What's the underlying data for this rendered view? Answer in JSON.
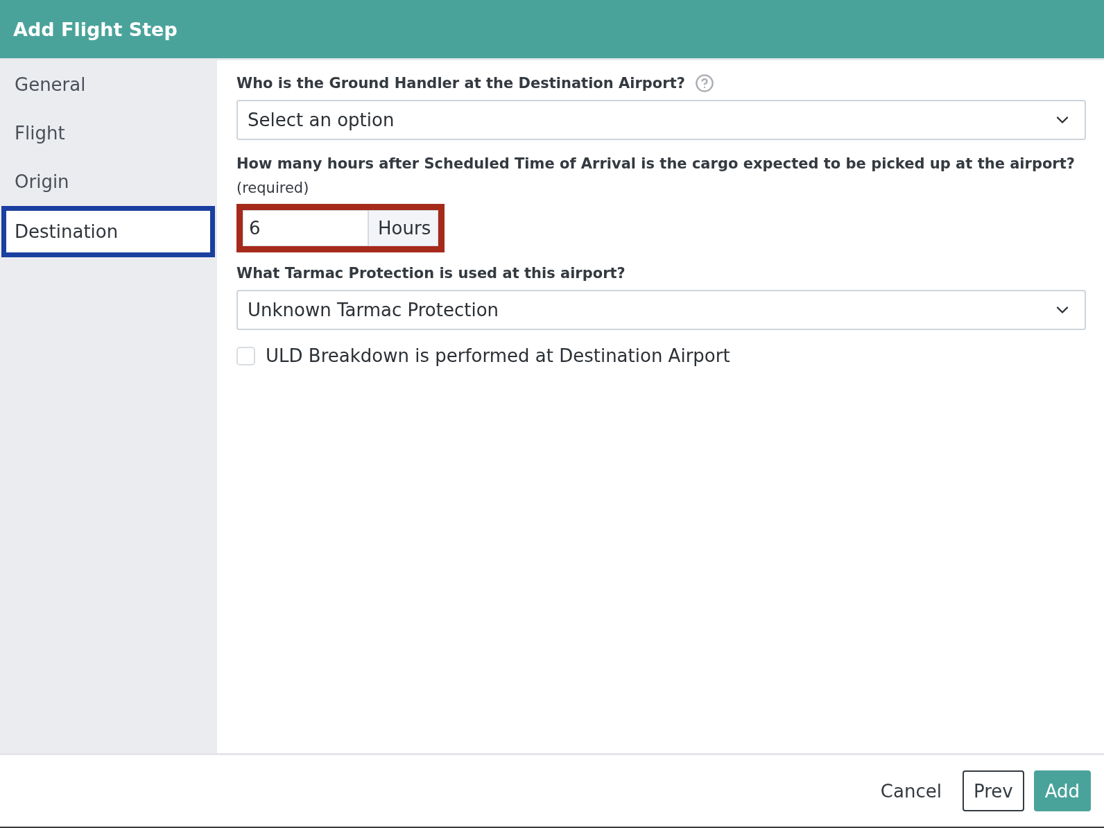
{
  "dialog": {
    "title": "Add Flight Step"
  },
  "sidebar": {
    "items": [
      {
        "label": "General",
        "selected": false,
        "outlined": false
      },
      {
        "label": "Flight",
        "selected": false,
        "outlined": false
      },
      {
        "label": "Origin",
        "selected": false,
        "outlined": false
      },
      {
        "label": "Destination",
        "selected": true,
        "outlined": true
      }
    ]
  },
  "form": {
    "fields": [
      {
        "kind": "select",
        "label": "Who is the Ground Handler at the Destination Airport?",
        "help": true,
        "placeholder": "Select an option"
      },
      {
        "kind": "number",
        "label": "How many hours after Scheduled Time of Arrival is the cargo expected to be picked up at the airport?",
        "note": "(required)",
        "value": "6",
        "unit": "Hours",
        "outlined": true
      },
      {
        "kind": "select",
        "label": "What Tarmac Protection is used at this airport?",
        "value": "Unknown Tarmac Protection"
      },
      {
        "kind": "checkbox",
        "label": "ULD Breakdown is performed at Destination Airport",
        "checked": false
      }
    ]
  },
  "footer": {
    "buttons": [
      {
        "label": "Cancel",
        "kind": "link"
      },
      {
        "label": "Prev",
        "kind": "outline"
      },
      {
        "label": "Add",
        "kind": "primary"
      }
    ]
  }
}
